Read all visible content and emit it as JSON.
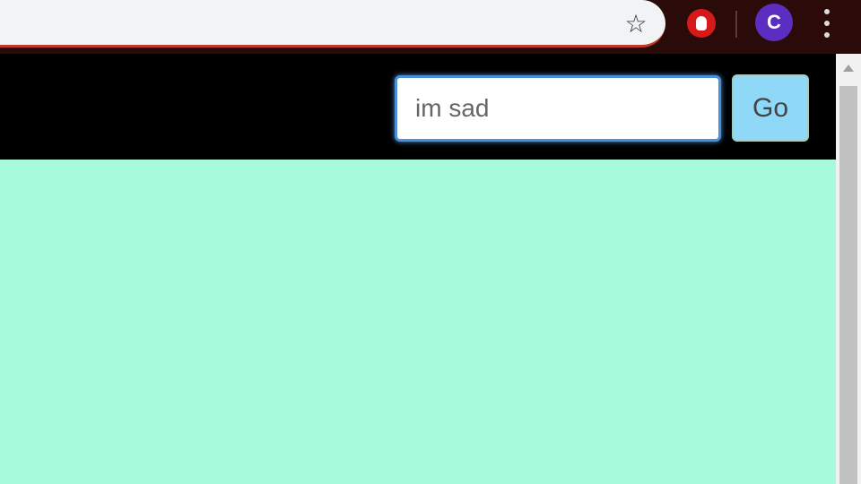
{
  "browser": {
    "icons": {
      "bookmark": "star-icon",
      "extension": "hand-stop-extension-icon",
      "menu": "vertical-dots-icon"
    },
    "profile_initial": "C",
    "colors": {
      "toolbar": "#2b0a0a",
      "avatar": "#5b2dc0",
      "extension": "#d61a1a"
    }
  },
  "header": {
    "search_value": "im sad",
    "go_label": "Go",
    "colors": {
      "background": "#000000",
      "go_button": "#8fd8f7"
    }
  },
  "content": {
    "background": "#a7fbdc"
  }
}
